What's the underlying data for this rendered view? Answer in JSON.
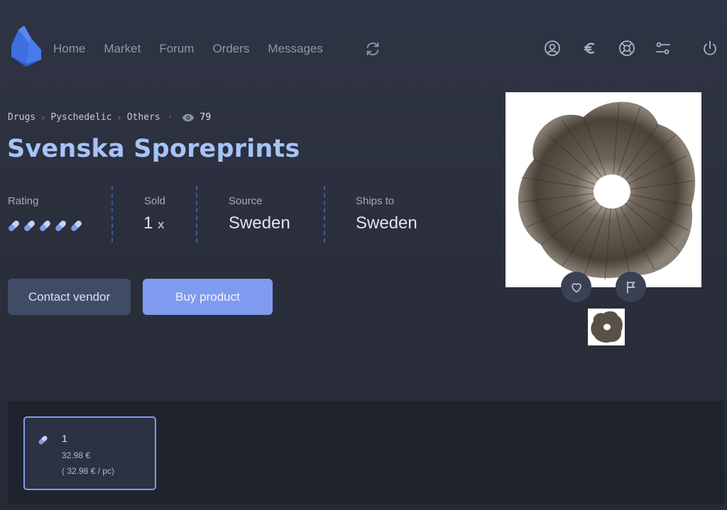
{
  "nav": {
    "items": [
      {
        "label": "Home"
      },
      {
        "label": "Market"
      },
      {
        "label": "Forum"
      },
      {
        "label": "Orders"
      },
      {
        "label": "Messages"
      }
    ],
    "refresh_icon": "refresh-icon",
    "right_icons": [
      "user-profile-icon",
      "euro-icon",
      "support-lifebuoy-icon",
      "settings-sliders-icon",
      "power-icon"
    ]
  },
  "breadcrumb": {
    "items": [
      "Drugs",
      "Pyschedelic",
      "Others"
    ],
    "views": "79",
    "views_icon": "eye-icon"
  },
  "product": {
    "title": "Svenska Sporeprints",
    "stats": {
      "rating_label": "Rating",
      "rating_value": 5,
      "rating_max": 5,
      "rating_icon": "pill-icon",
      "sold_label": "Sold",
      "sold_value": "1",
      "sold_suffix": "x",
      "source_label": "Source",
      "source_value": "Sweden",
      "ships_label": "Ships to",
      "ships_value": "Sweden"
    },
    "buttons": {
      "contact": "Contact vendor",
      "buy": "Buy product"
    },
    "image_icons": [
      "heart-icon",
      "flag-icon"
    ]
  },
  "options": [
    {
      "qty": "1",
      "price": "32.98 €",
      "per_unit": "( 32.98 € / pc)"
    }
  ],
  "colors": {
    "accent": "#7f9bef",
    "title": "#a6c3f7",
    "background": "#2c3140",
    "panel": "#1f232d"
  }
}
